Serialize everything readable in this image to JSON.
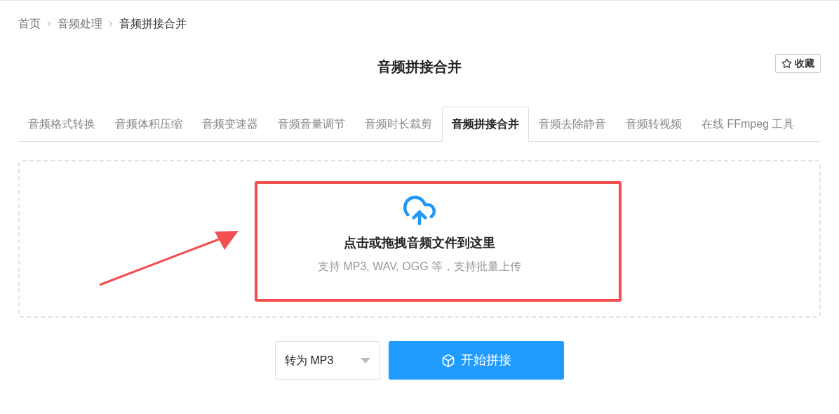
{
  "breadcrumb": [
    "首页",
    "音频处理",
    "音频拼接合并"
  ],
  "title": "音频拼接合并",
  "favorite_button": "收藏",
  "tabs": [
    {
      "label": "音频格式转换",
      "selected": false
    },
    {
      "label": "音频体积压缩",
      "selected": false
    },
    {
      "label": "音频变速器",
      "selected": false
    },
    {
      "label": "音频音量调节",
      "selected": false
    },
    {
      "label": "音频时长裁剪",
      "selected": false
    },
    {
      "label": "音频拼接合并",
      "selected": true
    },
    {
      "label": "音频去除静音",
      "selected": false
    },
    {
      "label": "音频转视频",
      "selected": false
    },
    {
      "label": "在线 FFmpeg 工具",
      "selected": false
    }
  ],
  "upload": {
    "heading": "点击或拖拽音频文件到这里",
    "hint": "支持 MP3, WAV, OGG 等，支持批量上传"
  },
  "format_select": {
    "value": "转为 MP3"
  },
  "start_button": "开始拼接"
}
